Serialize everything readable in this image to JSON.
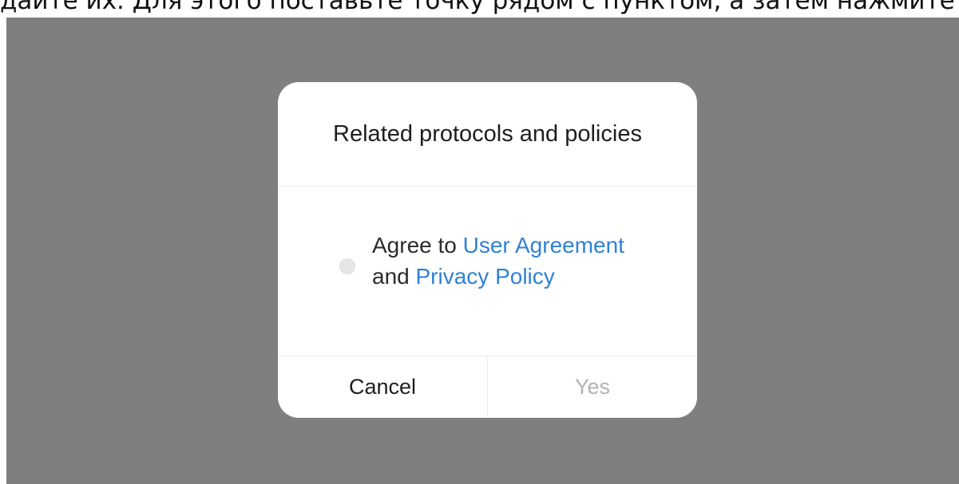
{
  "caption": {
    "text": "дайте их. Для этого поставьте точку рядом с пунктом, а затем нажмите Yes."
  },
  "dialog": {
    "title": "Related protocols and policies",
    "consent": {
      "checked": false,
      "prefix": "Agree to ",
      "user_agreement_link": "User Agreement",
      "connector": " and ",
      "privacy_policy_link": "Privacy Policy"
    },
    "buttons": {
      "cancel": "Cancel",
      "yes": "Yes"
    }
  },
  "colors": {
    "overlay": "#7f7f7f",
    "link": "#2f82d4",
    "disabled_text": "#b3b3b3",
    "text": "#1e1e1e"
  }
}
